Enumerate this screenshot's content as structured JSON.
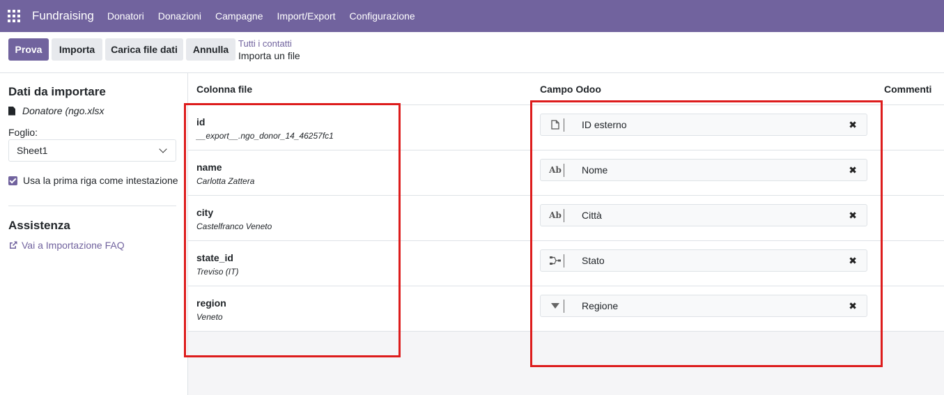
{
  "navbar": {
    "brand": "Fundraising",
    "items": [
      "Donatori",
      "Donazioni",
      "Campagne",
      "Import/Export",
      "Configurazione"
    ]
  },
  "toolbar": {
    "test_label": "Prova",
    "import_label": "Importa",
    "upload_label": "Carica file dati",
    "cancel_label": "Annulla"
  },
  "breadcrumb": {
    "parent": "Tutti i contatti",
    "current": "Importa un file"
  },
  "sidebar": {
    "title": "Dati da importare",
    "file_name": "Donatore (ngo.xlsx",
    "sheet_label": "Foglio:",
    "sheet_value": "Sheet1",
    "header_checkbox_label": "Usa la prima riga come intestazione",
    "header_checkbox_checked": true,
    "help_title": "Assistenza",
    "faq_link": "Vai a Importazione FAQ"
  },
  "table": {
    "headers": {
      "file_column": "Colonna file",
      "odoo_field": "Campo Odoo",
      "comments": "Commenti"
    },
    "rows": [
      {
        "column": "id",
        "sample": "__export__.ngo_donor_14_46257fc1",
        "field": "ID esterno",
        "type_icon": "file-icon"
      },
      {
        "column": "name",
        "sample": "Carlotta Zattera",
        "field": "Nome",
        "type_icon": "text-ab-icon"
      },
      {
        "column": "city",
        "sample": "Castelfranco Veneto",
        "field": "Città",
        "type_icon": "text-ab-icon"
      },
      {
        "column": "state_id",
        "sample": "Treviso (IT)",
        "field": "Stato",
        "type_icon": "relation-icon"
      },
      {
        "column": "region",
        "sample": "Veneto",
        "field": "Regione",
        "type_icon": "selection-triangle-icon"
      }
    ]
  },
  "colors": {
    "brand": "#71639e",
    "annotation": "#dd1c1c"
  }
}
